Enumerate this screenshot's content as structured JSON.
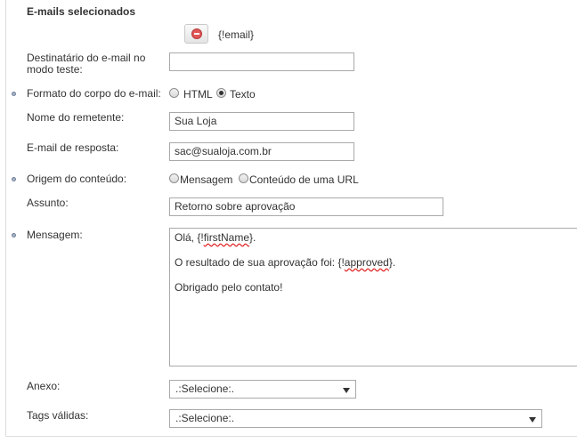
{
  "section": {
    "title": "E-mails selecionados"
  },
  "selected_email": {
    "value": "{!email}"
  },
  "test_recipient": {
    "label_line1": "Destinatário do e-mail no",
    "label_line2": "modo teste:",
    "value": ""
  },
  "body_format": {
    "label": "Formato do corpo do e-mail:",
    "options": [
      "HTML",
      "Texto"
    ],
    "selected": "Texto"
  },
  "sender_name": {
    "label": "Nome do remetente:",
    "value": "Sua Loja"
  },
  "reply_email": {
    "label": "E-mail de resposta:",
    "value": "sac@sualoja.com.br"
  },
  "content_origin": {
    "label": "Origem do conteúdo:",
    "options": [
      "Mensagem",
      "Conteúdo de uma URL"
    ],
    "selected": "none"
  },
  "subject": {
    "label": "Assunto:",
    "value": "Retorno sobre aprovação"
  },
  "message": {
    "label": "Mensagem:",
    "line1_prefix": "Olá, {!",
    "line1_var": "firstName",
    "line1_suffix": "}.",
    "line2_prefix": "O resultado de sua aprovação foi: {!",
    "line2_var": "approved",
    "line2_suffix": "}.",
    "line3": "Obrigado pelo contato!"
  },
  "attachment": {
    "label": "Anexo:",
    "selected": ".:Selecione:."
  },
  "valid_tags": {
    "label": "Tags válidas:",
    "selected": ".:Selecione:."
  },
  "colors": {
    "bullet": "#a8b5c8",
    "spellcheck": "#e02020",
    "remove_icon": "#e05656"
  }
}
